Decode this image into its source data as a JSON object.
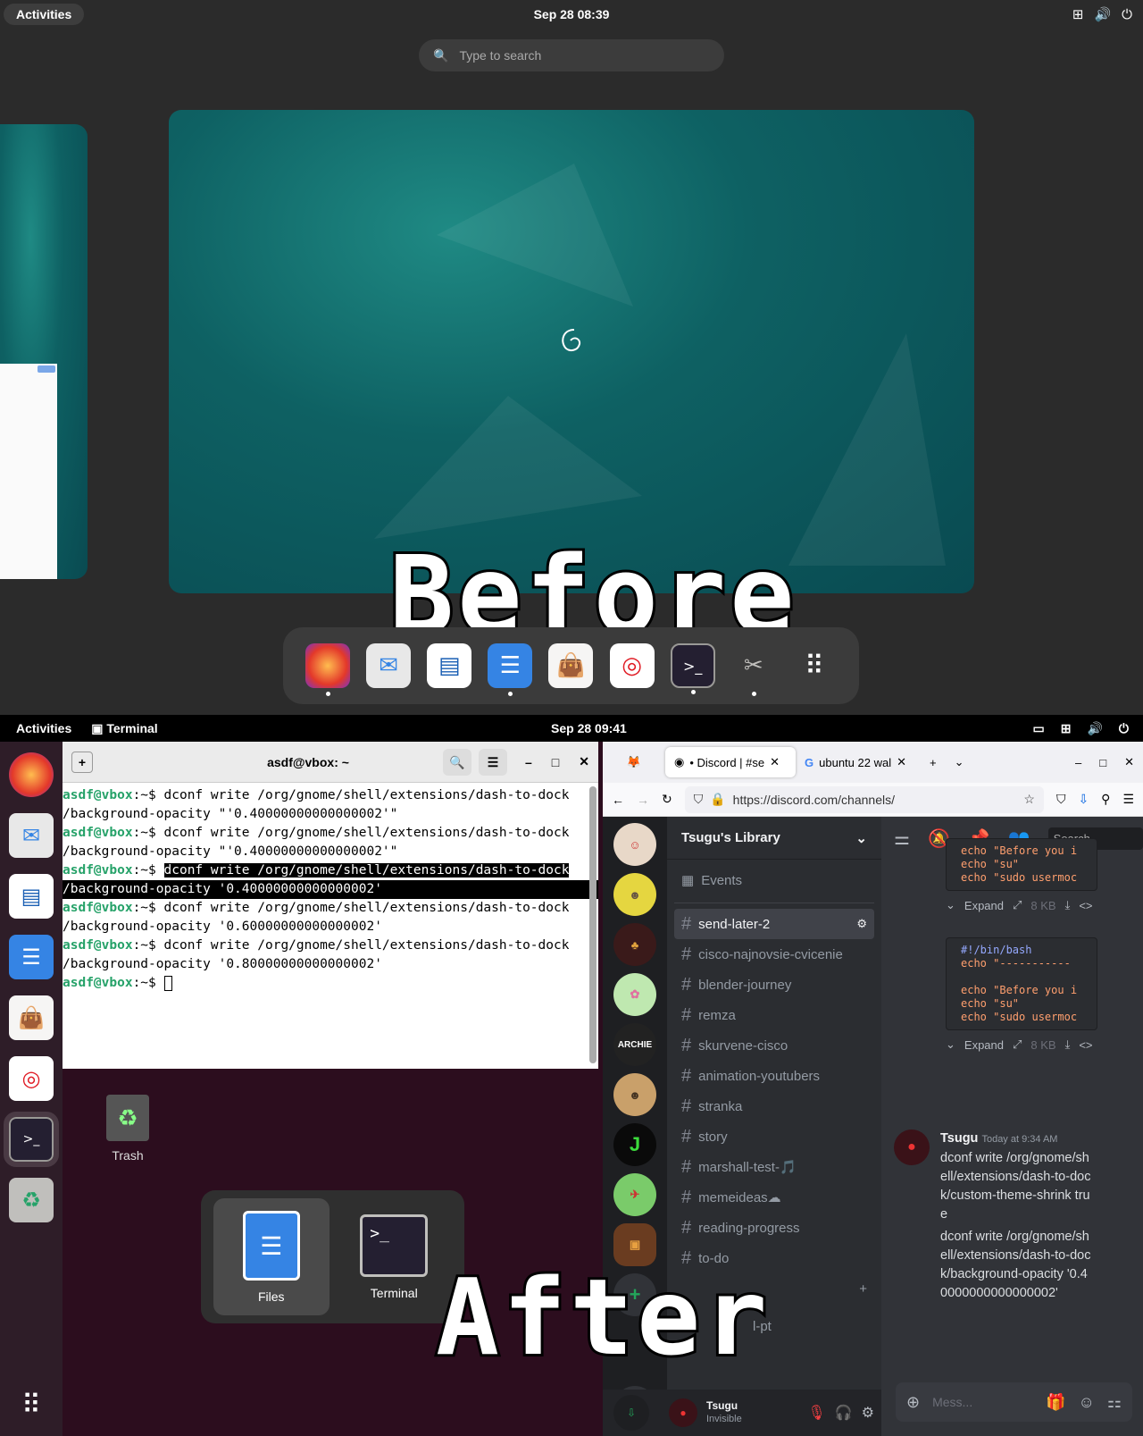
{
  "before": {
    "activities": "Activities",
    "clock": "Sep 28  08:39",
    "search_placeholder": "Type to search",
    "caption": "Before",
    "dock_icons": [
      "firefox-icon",
      "evolution-icon",
      "writer-icon",
      "files-icon",
      "software-icon",
      "help-icon",
      "terminal-icon",
      "tweaks-icon",
      "app-grid-icon"
    ]
  },
  "after": {
    "activities": "Activities",
    "app_label": "Terminal",
    "clock": "Sep 28  09:41",
    "caption": "After",
    "trash_label": "Trash"
  },
  "terminal": {
    "title": "asdf@vbox: ~",
    "prompt": "asdf@vbox",
    "prompt_suffix": ":~$ ",
    "lines": [
      {
        "cmd": "dconf write /org/gnome/shell/extensions/dash-to-dock",
        "cont": "/background-opacity \"'0.40000000000000002'\"",
        "sel": false
      },
      {
        "cmd": "dconf write /org/gnome/shell/extensions/dash-to-dock",
        "cont": "/background-opacity \"'0.40000000000000002'\"",
        "sel": false
      },
      {
        "cmd": "dconf write /org/gnome/shell/extensions/dash-to-dock",
        "cont": "/background-opacity '0.40000000000000002'",
        "sel": true
      },
      {
        "cmd": "dconf write /org/gnome/shell/extensions/dash-to-dock",
        "cont": "/background-opacity '0.60000000000000002'",
        "sel": false
      },
      {
        "cmd": "dconf write /org/gnome/shell/extensions/dash-to-dock",
        "cont": "/background-opacity '0.80000000000000002'",
        "sel": false
      }
    ]
  },
  "switcher": {
    "files": "Files",
    "terminal": "Terminal"
  },
  "firefox": {
    "tab1": "• Discord | #se",
    "tab2": "ubuntu 22 wal",
    "url": "https://discord.com/channels/"
  },
  "discord": {
    "server_name": "Tsugu's Library",
    "events": "Events",
    "search": "Search",
    "channels": [
      "send-later-2",
      "cisco-najnovsie-cvicenie",
      "blender-journey",
      "remza",
      "skurvene-cisco",
      "animation-youtubers",
      "stranka",
      "story",
      "marshall-test-🎵",
      "memeideas☁",
      "reading-progress",
      "to-do"
    ],
    "partial_channel": "l-pt",
    "code1": [
      "echo \"Before you i",
      "echo \"su\"",
      "echo \"sudo usermoc"
    ],
    "code2_head": "#!/bin/bash",
    "code2": [
      "echo \"-----------",
      "",
      "echo \"Before you i",
      "echo \"su\"",
      "echo \"sudo usermoc"
    ],
    "expand": "Expand",
    "size": "8 KB",
    "author": "Tsugu",
    "timestamp": "Today at 9:34 AM",
    "msg1": "dconf write /org/gnome/shell/extensions/dash-to-dock/custom-theme-shrink true",
    "msg2": "dconf write /org/gnome/shell/extensions/dash-to-dock/background-opacity '0.40000000000000002'",
    "input_placeholder": "Mess...",
    "user": "Tsugu",
    "status": "Invisible"
  }
}
